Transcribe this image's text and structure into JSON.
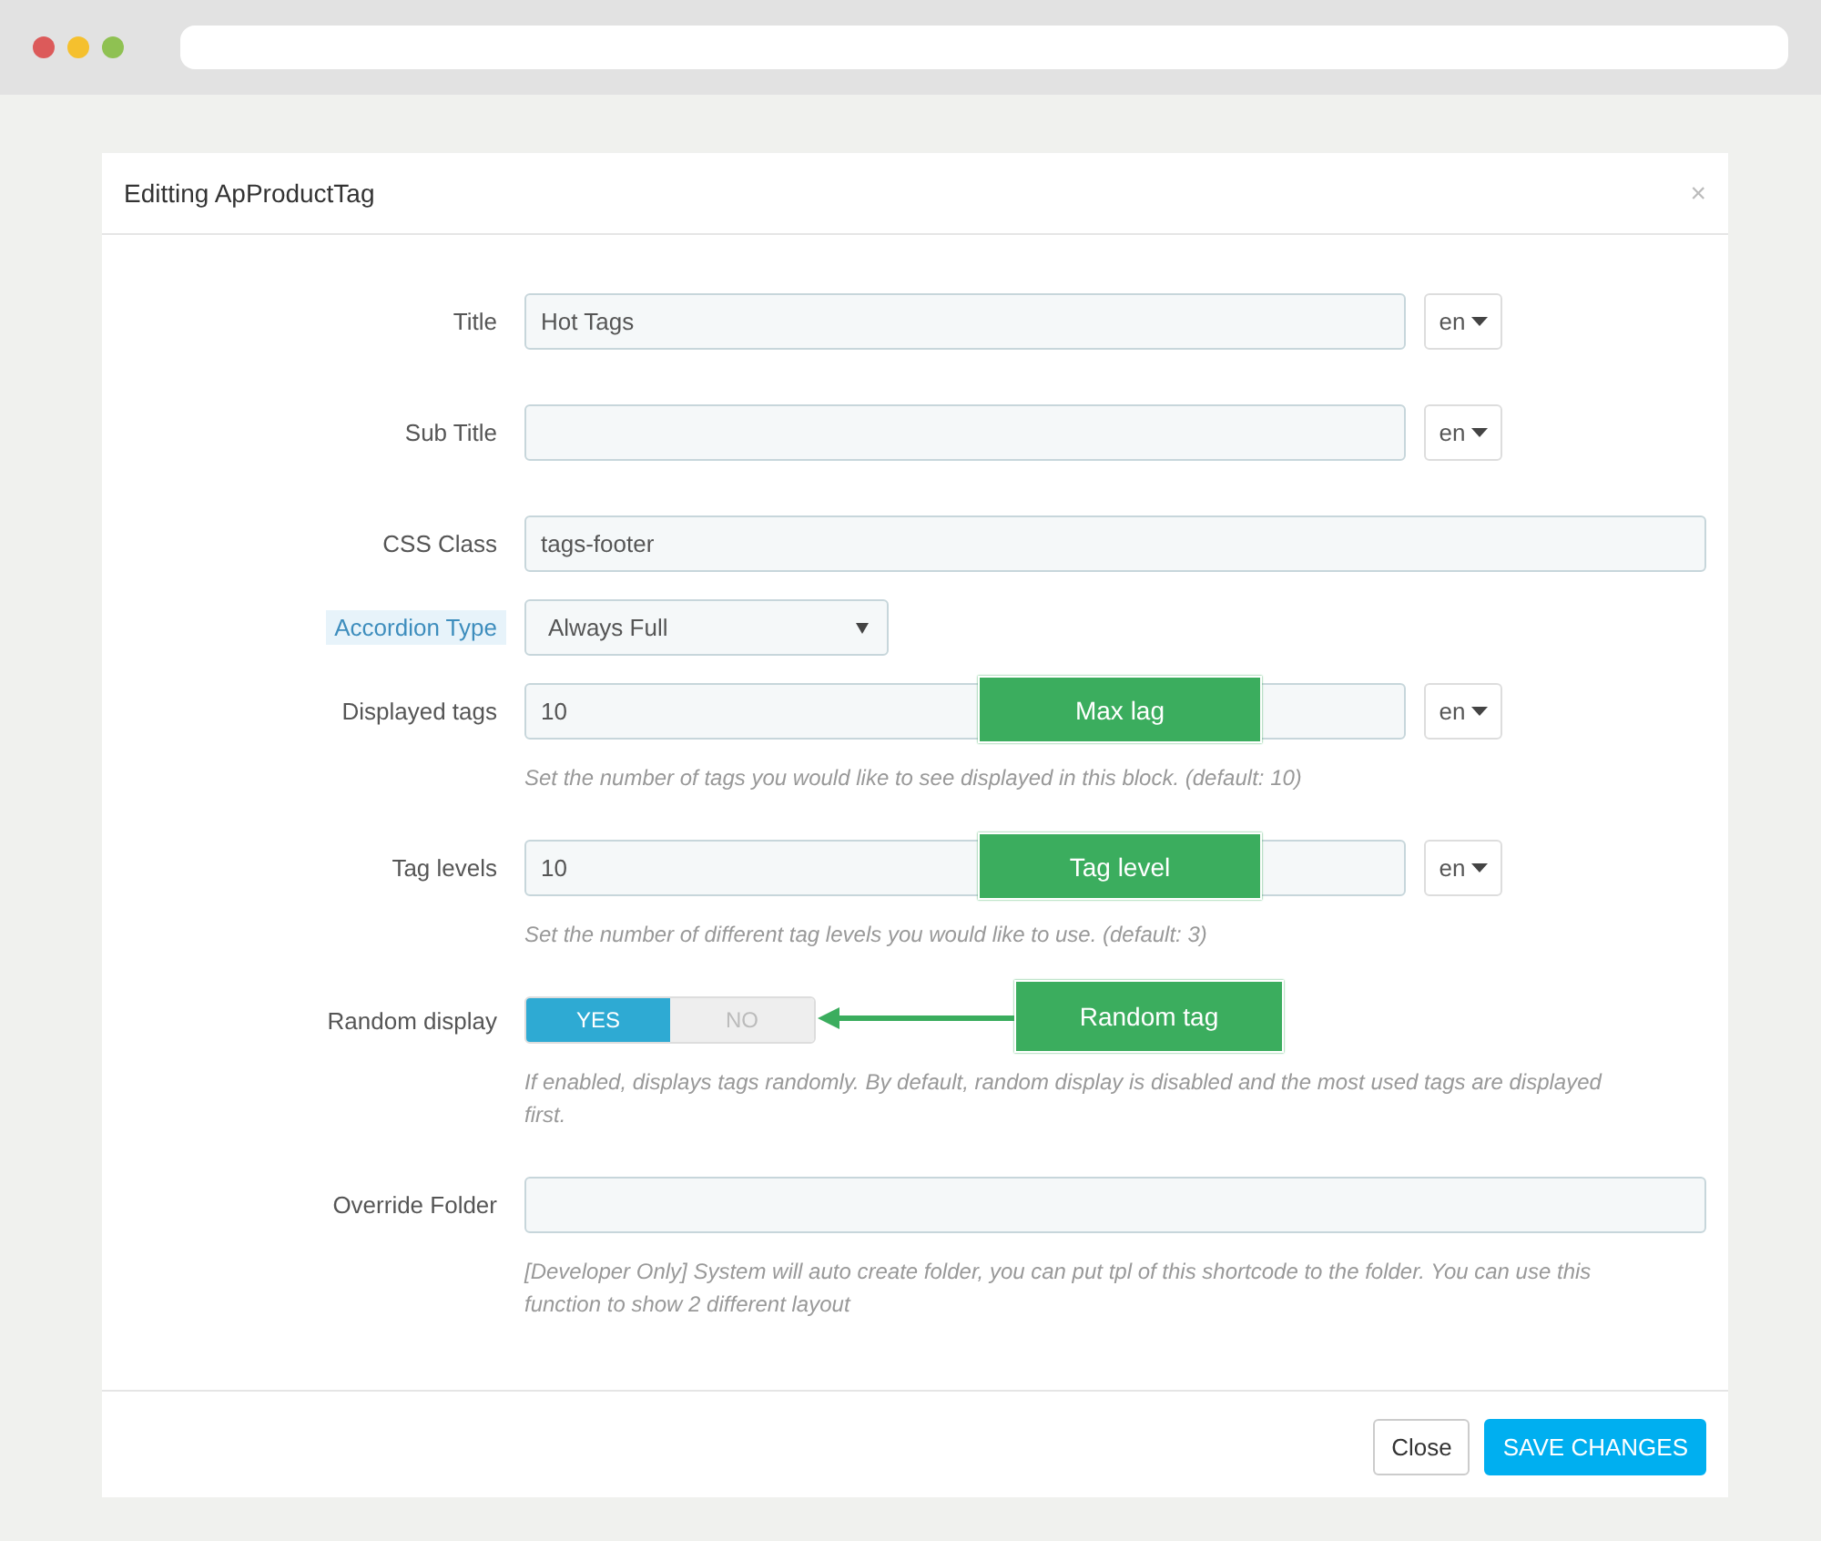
{
  "modal": {
    "title": "Editting ApProductTag",
    "close_glyph": "×"
  },
  "fields": [
    {
      "kind": "text",
      "label": "Title",
      "highlighted": false,
      "value": "Hot Tags",
      "lang": "en"
    },
    {
      "kind": "text",
      "label": "Sub Title",
      "highlighted": false,
      "lang": "en"
    },
    {
      "kind": "text",
      "label": "CSS Class",
      "highlighted": false,
      "value": "tags-footer"
    },
    {
      "kind": "select",
      "label": "Accordion Type",
      "highlighted": true,
      "value": "Always Full"
    },
    {
      "kind": "text",
      "label": "Displayed tags",
      "highlighted": false,
      "value": "10",
      "lang": "en",
      "help": "Set the number of tags you would like to see displayed in this block. (default: 10)",
      "callout": "Max lag"
    },
    {
      "kind": "text",
      "label": "Tag levels",
      "highlighted": false,
      "value": "10",
      "lang": "en",
      "help": "Set the number of different tag levels you would like to use. (default: 3)",
      "callout": "Tag level"
    },
    {
      "kind": "toggle",
      "label": "Random display",
      "highlighted": false,
      "options": [
        {
          "label": "YES",
          "selected": true
        },
        {
          "label": "NO",
          "selected": false
        }
      ],
      "help": "If enabled, displays tags randomly. By default, random display is disabled and the most used tags are displayed first.",
      "callout": "Random tag"
    },
    {
      "kind": "text",
      "label": "Override Folder",
      "highlighted": false,
      "help": "[Developer Only] System will auto create folder, you can put tpl of this shortcode to the folder. You can use this function to show 2 different layout"
    }
  ],
  "footer": {
    "buttons": [
      {
        "label": "Close",
        "kind": "default"
      },
      {
        "label": "SAVE CHANGES",
        "kind": "primary"
      }
    ]
  }
}
